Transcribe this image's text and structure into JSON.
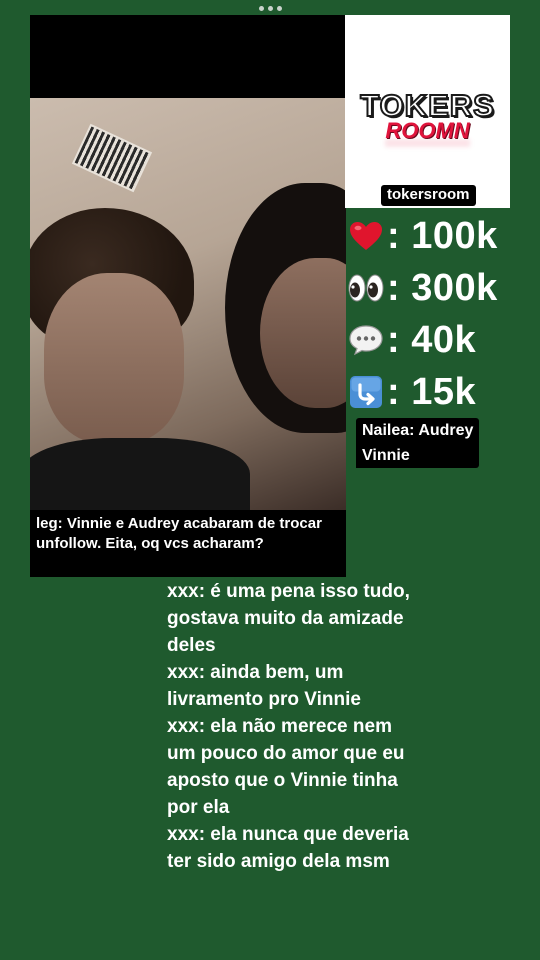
{
  "page": {
    "background_color": "#1f5a2e"
  },
  "post": {
    "caption": "leg: Vinnie e Audrey acabaram de trocar unfollow. Eita, oq vcs acharam?"
  },
  "brand": {
    "logo_line1": "TOKERS",
    "logo_line2": "ROOMN",
    "handle": "tokersroom",
    "accent_color": "#e0143c"
  },
  "stats": [
    {
      "icon": "heart-icon",
      "value": ": 100k"
    },
    {
      "icon": "eyes-icon",
      "value": ": 300k"
    },
    {
      "icon": "speech-bubble-icon",
      "value": ": 40k"
    },
    {
      "icon": "share-arrow-icon",
      "value": ": 15k"
    }
  ],
  "tag": {
    "line1": "Nailea: Audrey",
    "line2": "Vinnie"
  },
  "comments": [
    "xxx: é uma pena isso tudo, gostava muito da amizade deles",
    "xxx: ainda bem, um livramento pro Vinnie",
    "xxx: ela não merece nem um pouco do amor que eu aposto que o Vinnie tinha por ela",
    "xxx: ela nunca que deveria ter sido amigo dela msm"
  ]
}
